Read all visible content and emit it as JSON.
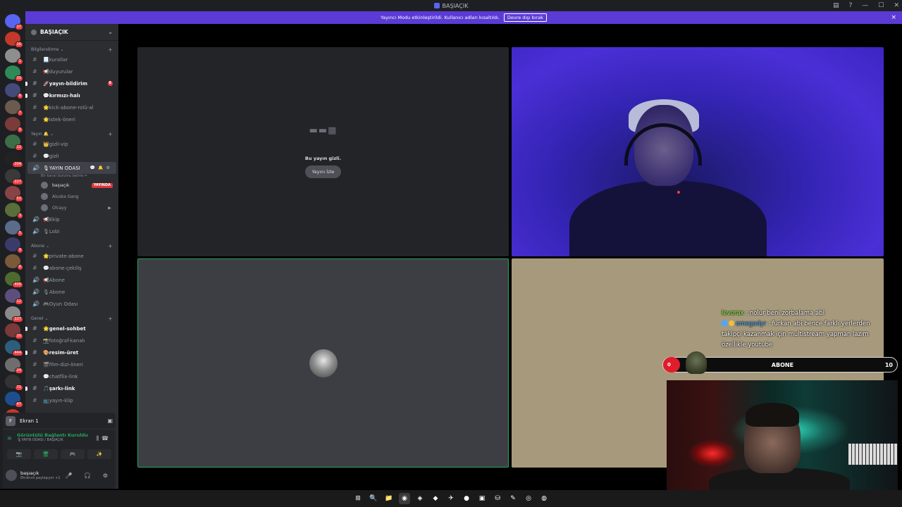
{
  "window": {
    "title": "BAŞIAÇIK"
  },
  "banner": {
    "text": "Yayıncı Modu etkinleştirildi. Kullanıcı adları kısaltıldı.",
    "button": "Devre dışı bırak",
    "close": "×"
  },
  "server_rail": [
    {
      "badge": "17",
      "color": "#5865f2"
    },
    {
      "badge": "16",
      "color": "#c0392b"
    },
    {
      "badge": "1",
      "color": "#8e8e8e"
    },
    {
      "badge": "33",
      "color": "#2e8b57"
    },
    {
      "badge": "6",
      "color": "#444a7a"
    },
    {
      "badge": "7",
      "color": "#6b5b4e"
    },
    {
      "badge": "5",
      "color": "#7a3b3b"
    },
    {
      "badge": "11",
      "color": "#3c6e47"
    },
    {
      "badge": "204",
      "color": "#222222"
    },
    {
      "badge": "227",
      "color": "#3a3a3a"
    },
    {
      "badge": "53",
      "color": "#884444"
    },
    {
      "badge": "3",
      "color": "#5a6e3a"
    },
    {
      "badge": "5",
      "color": "#5b6b8a"
    },
    {
      "badge": "9",
      "color": "#3b3b6b"
    },
    {
      "badge": "6",
      "color": "#7a5a3a"
    },
    {
      "badge": "406",
      "color": "#4e6b2e"
    },
    {
      "badge": "12",
      "color": "#5e4e7e"
    },
    {
      "badge": "127",
      "color": "#8a8a8a"
    },
    {
      "badge": "10",
      "color": "#7a3a3a"
    },
    {
      "badge": "444",
      "color": "#2e5e7e"
    },
    {
      "badge": "24",
      "color": "#6e6e6e"
    },
    {
      "badge": "71",
      "color": "#333333"
    },
    {
      "badge": "47",
      "color": "#1e4e8e"
    },
    {
      "badge": "YENİ",
      "color": "#c0392b"
    }
  ],
  "sidebar": {
    "server_name": "BAŞIAÇIK",
    "sections": [
      {
        "category": "Bilgilendirme",
        "channels": [
          {
            "icon": "#",
            "name": "📃kurallar",
            "unread": false
          },
          {
            "icon": "#",
            "name": "📢duyurular",
            "unread": false
          },
          {
            "icon": "#",
            "name": "🚀yayın-bildirim",
            "unread": true,
            "badge": "6"
          },
          {
            "icon": "#",
            "name": "💬kırmızı-halı",
            "unread": true
          },
          {
            "icon": "#",
            "name": "🌟kick-abone-rolü-al",
            "unread": false
          },
          {
            "icon": "#",
            "name": "🌟istek-öneri",
            "unread": false
          }
        ]
      },
      {
        "category": "Yayın 🔔",
        "channels": [
          {
            "icon": "#",
            "name": "👑gizli-vip",
            "unread": false
          },
          {
            "icon": "#",
            "name": "💬gizli",
            "unread": false
          }
        ]
      }
    ],
    "voice_active": {
      "name": "🎙YAYIN ODASI",
      "tools": "💬 🔔 ⚙",
      "status": "Bir kanal durumu belirle ✏",
      "users": [
        {
          "name": "başıaçık",
          "live": "YAYINDA"
        },
        {
          "name": "Aluska Gang"
        },
        {
          "name": "Olcayy",
          "cam": "▶"
        }
      ]
    },
    "voice_more": [
      {
        "name": "📢Ekip"
      },
      {
        "name": "🎙Lobi"
      }
    ],
    "sections2": [
      {
        "category": "Abone",
        "channels": [
          {
            "icon": "#",
            "name": "🌟private-abone",
            "unread": false
          },
          {
            "icon": "#",
            "name": "💬abone-çekiliş",
            "unread": false
          },
          {
            "icon": "🔊",
            "name": "📢Abone",
            "unread": false
          },
          {
            "icon": "🔊",
            "name": "🎙Abone",
            "unread": false
          },
          {
            "icon": "🔊",
            "name": "🎮Oyun Odası",
            "unread": false
          }
        ]
      },
      {
        "category": "Genel",
        "channels": [
          {
            "icon": "#",
            "name": "🌟genel-sohbet",
            "unread": true
          },
          {
            "icon": "#",
            "name": "📸fotoğraf-kanalı",
            "unread": false
          },
          {
            "icon": "#",
            "name": "🎨resim-üret",
            "unread": true
          },
          {
            "icon": "#",
            "name": "🎬film-dizi-öneri",
            "unread": false
          },
          {
            "icon": "#",
            "name": "💬chatflix-link",
            "unread": false
          },
          {
            "icon": "#",
            "name": "🎵şarkı-link",
            "unread": true
          },
          {
            "icon": "#",
            "name": "📺yayın-klip",
            "unread": false
          }
        ]
      }
    ]
  },
  "user_panel": {
    "screen_label": "Ekran 1",
    "connection_title": "Görüntülü Bağlantı Kuruldu",
    "connection_sub": "🎙YAYIN ODASI / BAŞIAÇIK",
    "buttons": [
      "📷",
      "🖥",
      "🎮",
      "✨"
    ],
    "username": "başıaçık",
    "user_status": "Ekranını paylaşıyor +1",
    "controls": "🎤 🎧 ⚙"
  },
  "stage": {
    "hidden_text": "Bu yayın gizli.",
    "watch_button": "Yayını İzle",
    "hidden_art": "▬▬▦"
  },
  "overlay": {
    "chat": [
      {
        "user": "levorax",
        "sep": " : ",
        "message": "nolur beni zorbalama abi"
      },
      {
        "user": "omegadyr",
        "sep": " : ",
        "message": "furkan abi bence farklı yerlerden takipçi kazanmak için multistream yapman lazım özellikle youtube"
      }
    ],
    "sub_goal": {
      "current": "0",
      "label": "ABONE",
      "goal": "10"
    }
  },
  "taskbar": {
    "apps": [
      "⊞",
      "🔍",
      "📁",
      "◉",
      "◈",
      "◆",
      "✈",
      "●",
      "▣",
      "⛁",
      "✎",
      "◎",
      "◍"
    ]
  }
}
